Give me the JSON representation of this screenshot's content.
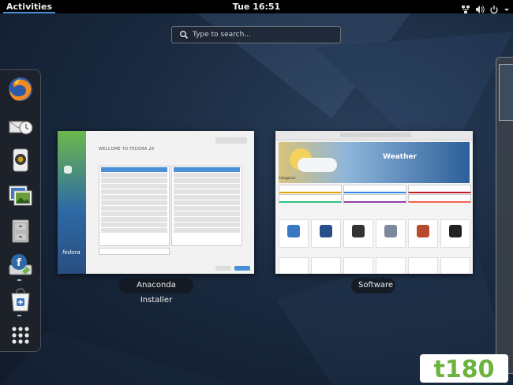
{
  "topbar": {
    "activities_label": "Activities",
    "clock": "Tue 16:51",
    "icons": [
      "network-icon",
      "volume-icon",
      "power-icon",
      "chevron-down-icon"
    ]
  },
  "search": {
    "placeholder": "Type to search..."
  },
  "dash": {
    "apps": [
      {
        "icon": "firefox-icon",
        "running": false
      },
      {
        "icon": "evolution-icon",
        "running": false
      },
      {
        "icon": "rhythmbox-icon",
        "running": false
      },
      {
        "icon": "shotwell-icon",
        "running": false
      },
      {
        "icon": "files-icon",
        "running": false
      },
      {
        "icon": "anaconda-installer-icon",
        "running": true
      },
      {
        "icon": "software-icon",
        "running": true
      },
      {
        "icon": "show-applications-icon",
        "running": false
      }
    ]
  },
  "windows": [
    {
      "caption": "Anaconda Installer",
      "screen_title": "WELCOME TO FEDORA 26",
      "brand": "fedora"
    },
    {
      "caption": "Software",
      "banner_title": "Weather",
      "section": "Categories"
    }
  ],
  "watermark": {
    "text": "t180"
  },
  "colors": {
    "accent": "#4a90d9",
    "topbar": "#000000",
    "fedora_green": "#6cb84b",
    "fedora_blue": "#2e6aa5"
  }
}
